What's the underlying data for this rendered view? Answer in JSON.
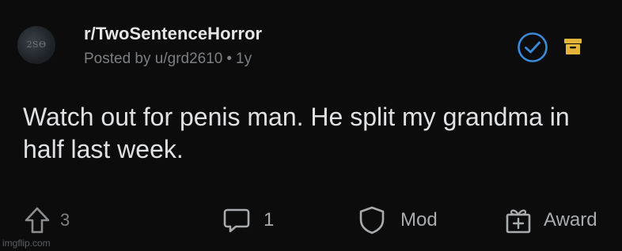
{
  "post": {
    "subreddit": "r/TwoSentenceHorror",
    "posted_by_prefix": "Posted by",
    "username": "u/grd2610",
    "separator": "•",
    "age": "1y",
    "avatar_text": "2SΘ",
    "body": "Watch out for penis man. He split my grandma in half last week."
  },
  "actions": {
    "upvote_count": "3",
    "comment_count": "1",
    "mod_label": "Mod",
    "award_label": "Award"
  },
  "icons": {
    "upvote": "upvote-arrow-icon",
    "comment": "comment-bubble-icon",
    "mod": "shield-icon",
    "award": "gift-icon",
    "approve": "checkmark-circle-icon",
    "archive": "archive-box-icon"
  },
  "colors": {
    "background": "#0c0c0d",
    "approve_blue": "#3b8bd9",
    "archive_yellow": "#e2b43a",
    "muted_text": "#7c7f82"
  },
  "watermark": "imgflip.com"
}
